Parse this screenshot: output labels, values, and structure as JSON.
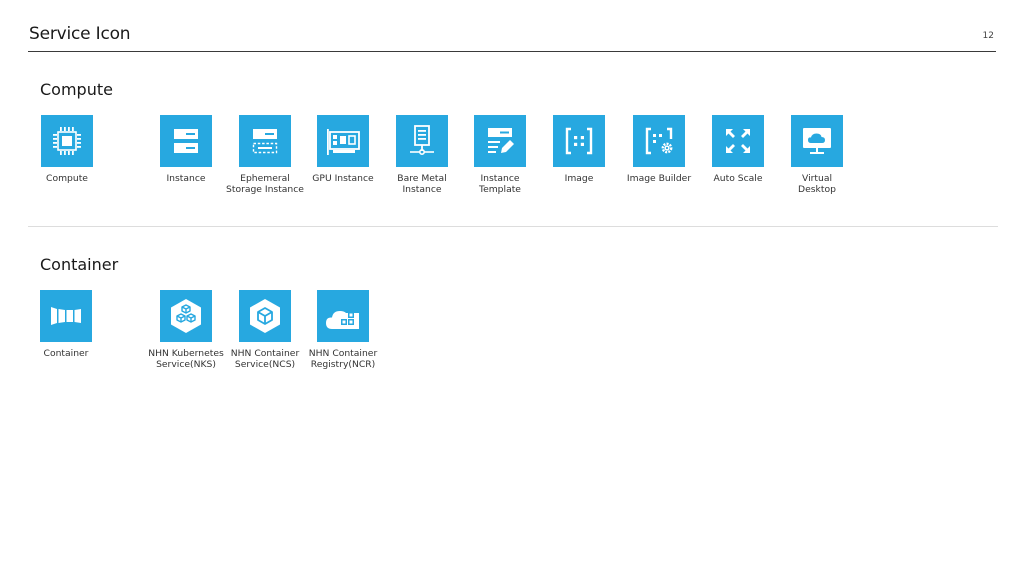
{
  "page": {
    "title": "Service Icon",
    "number": "12"
  },
  "colors": {
    "icon_background": "#27a8e0",
    "icon_foreground": "#ffffff"
  },
  "sections": [
    {
      "title": "Compute",
      "items": [
        {
          "label": "Compute",
          "icon": "cpu-chip-icon"
        },
        {
          "label": "Instance",
          "icon": "server-icon"
        },
        {
          "label": "Ephemeral\nStorage Instance",
          "icon": "ephemeral-storage-icon"
        },
        {
          "label": "GPU Instance",
          "icon": "gpu-card-icon"
        },
        {
          "label": "Bare Metal\nInstance",
          "icon": "bare-metal-server-icon"
        },
        {
          "label": "Instance\nTemplate",
          "icon": "instance-template-icon"
        },
        {
          "label": "Image",
          "icon": "image-bracket-icon"
        },
        {
          "label": "Image Builder",
          "icon": "image-builder-icon"
        },
        {
          "label": "Auto Scale",
          "icon": "auto-scale-icon"
        },
        {
          "label": "Virtual\nDesktop",
          "icon": "virtual-desktop-icon"
        }
      ]
    },
    {
      "title": "Container",
      "items": [
        {
          "label": "Container",
          "icon": "container-icon"
        },
        {
          "label": "NHN Kubernetes\nService(NKS)",
          "icon": "kubernetes-hexagon-icon"
        },
        {
          "label": "NHN Container\nService(NCS)",
          "icon": "container-service-hexagon-icon"
        },
        {
          "label": "NHN Container\nRegistry(NCR)",
          "icon": "container-registry-icon"
        }
      ]
    }
  ]
}
